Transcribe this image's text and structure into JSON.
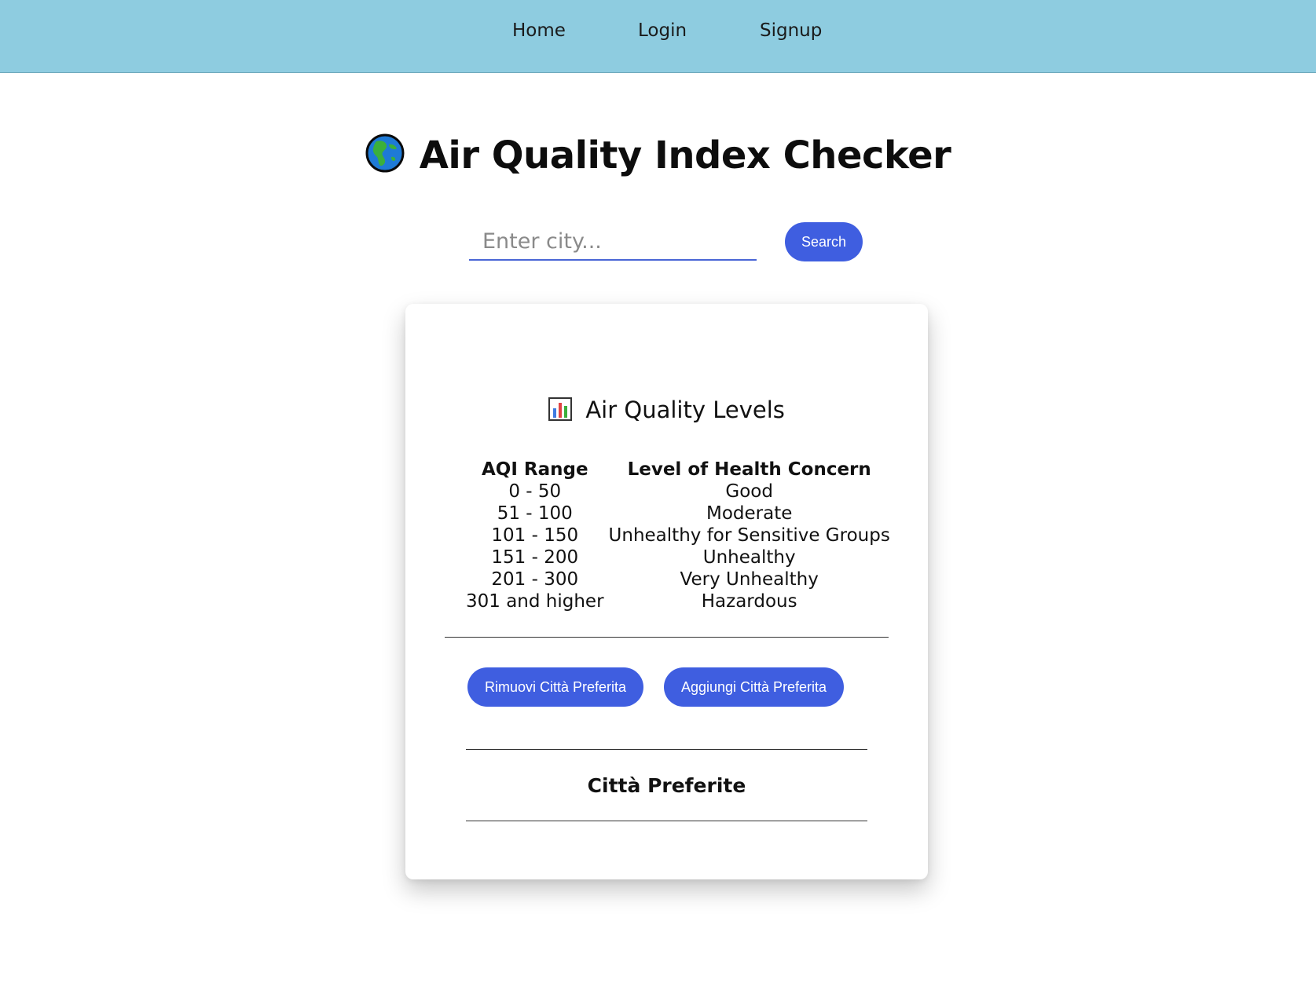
{
  "nav": {
    "items": [
      {
        "label": "Home"
      },
      {
        "label": "Login"
      },
      {
        "label": "Signup"
      }
    ]
  },
  "header": {
    "icon": "globe-icon",
    "title": "Air Quality Index Checker"
  },
  "search": {
    "placeholder": "Enter city...",
    "value": "",
    "button_label": "Search"
  },
  "levels": {
    "icon": "bar-chart-icon",
    "heading": "Air Quality Levels",
    "columns": [
      "AQI Range",
      "Level of Health Concern"
    ],
    "rows": [
      {
        "range": "0 - 50",
        "level": "Good"
      },
      {
        "range": "51 - 100",
        "level": "Moderate"
      },
      {
        "range": "101 - 150",
        "level": "Unhealthy for Sensitive Groups"
      },
      {
        "range": "151 - 200",
        "level": "Unhealthy"
      },
      {
        "range": "201 - 300",
        "level": "Very Unhealthy"
      },
      {
        "range": "301 and higher",
        "level": "Hazardous"
      }
    ]
  },
  "favorites": {
    "remove_label": "Rimuovi Città Preferita",
    "add_label": "Aggiungi Città Preferita",
    "heading": "Città Preferite"
  },
  "colors": {
    "navbar": "#8ecce0",
    "accent": "#3f5ee0"
  }
}
